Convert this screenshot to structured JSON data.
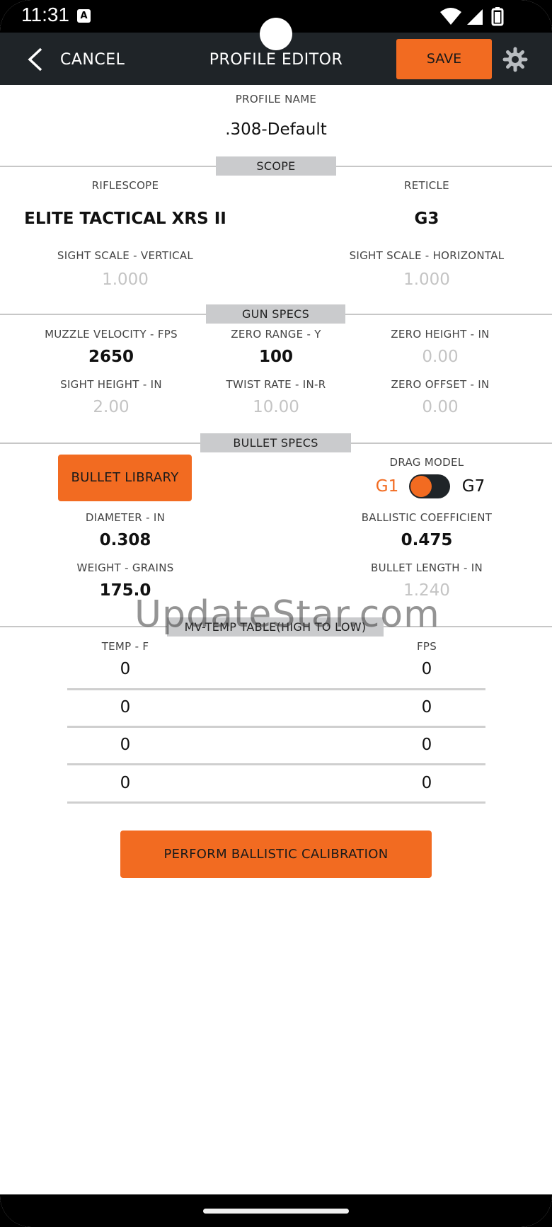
{
  "status_bar": {
    "time": "11:31",
    "notification_icon": "A"
  },
  "app_bar": {
    "cancel_label": "CANCEL",
    "title": "PROFILE EDITOR",
    "save_label": "SAVE"
  },
  "profile": {
    "name_label": "PROFILE NAME",
    "name_value": ".308-Default"
  },
  "scope": {
    "section_label": "SCOPE",
    "riflescope_label": "RIFLESCOPE",
    "riflescope_value": "ELITE TACTICAL XRS II",
    "reticle_label": "RETICLE",
    "reticle_value": "G3",
    "sight_v_label": "SIGHT SCALE - VERTICAL",
    "sight_v_value": "1.000",
    "sight_h_label": "SIGHT SCALE - HORIZONTAL",
    "sight_h_value": "1.000"
  },
  "gun": {
    "section_label": "GUN SPECS",
    "mv_label": "MUZZLE VELOCITY - FPS",
    "mv_value": "2650",
    "zero_range_label": "ZERO RANGE - Y",
    "zero_range_value": "100",
    "zero_height_label": "ZERO HEIGHT - IN",
    "zero_height_value": "0.00",
    "sight_height_label": "SIGHT HEIGHT - IN",
    "sight_height_value": "2.00",
    "twist_label": "TWIST RATE - IN-R",
    "twist_value": "10.00",
    "zero_offset_label": "ZERO OFFSET - IN",
    "zero_offset_value": "0.00"
  },
  "bullet": {
    "section_label": "BULLET SPECS",
    "library_button": "BULLET LIBRARY",
    "drag_label": "DRAG MODEL",
    "drag_g1": "G1",
    "drag_g7": "G7",
    "diameter_label": "DIAMETER - IN",
    "diameter_value": "0.308",
    "bc_label": "BALLISTIC COEFFICIENT",
    "bc_value": "0.475",
    "weight_label": "WEIGHT - GRAINS",
    "weight_value": "175.0",
    "length_label": "BULLET LENGTH - IN",
    "length_value": "1.240"
  },
  "mv_table": {
    "section_label": "MV-TEMP TABLE(HIGH TO LOW)",
    "temp_header": "TEMP - F",
    "fps_header": "FPS",
    "rows": [
      {
        "temp": "0",
        "fps": "0"
      },
      {
        "temp": "0",
        "fps": "0"
      },
      {
        "temp": "0",
        "fps": "0"
      },
      {
        "temp": "0",
        "fps": "0"
      }
    ]
  },
  "calibration_button": "PERFORM BALLISTIC CALIBRATION",
  "watermark": "UpdateStar.com",
  "colors": {
    "accent": "#f26b21",
    "app_bar": "#1f2428",
    "divider": "#c7c7c7"
  }
}
